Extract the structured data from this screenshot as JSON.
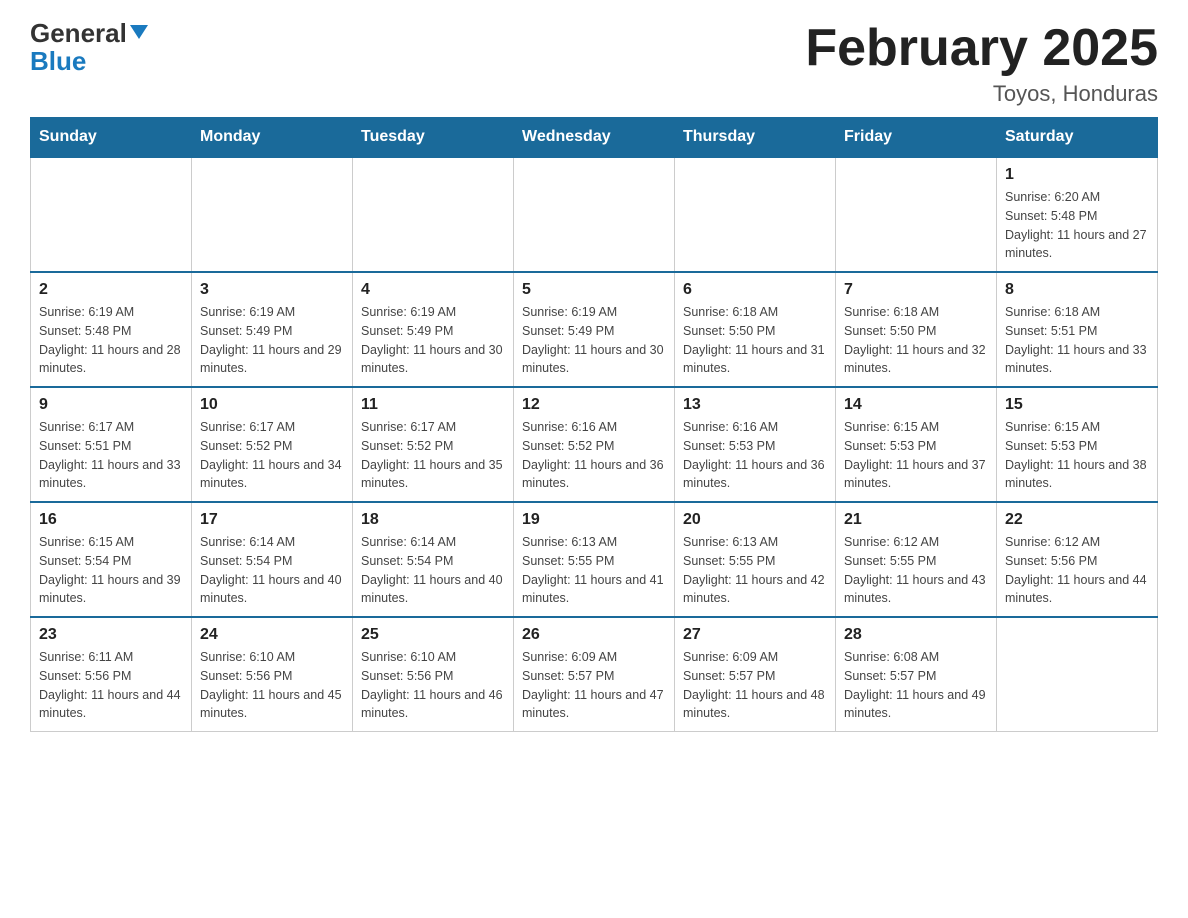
{
  "logo": {
    "general": "General",
    "blue": "Blue"
  },
  "header": {
    "month_title": "February 2025",
    "location": "Toyos, Honduras"
  },
  "weekdays": [
    "Sunday",
    "Monday",
    "Tuesday",
    "Wednesday",
    "Thursday",
    "Friday",
    "Saturday"
  ],
  "weeks": [
    [
      {
        "day": "",
        "info": ""
      },
      {
        "day": "",
        "info": ""
      },
      {
        "day": "",
        "info": ""
      },
      {
        "day": "",
        "info": ""
      },
      {
        "day": "",
        "info": ""
      },
      {
        "day": "",
        "info": ""
      },
      {
        "day": "1",
        "info": "Sunrise: 6:20 AM\nSunset: 5:48 PM\nDaylight: 11 hours and 27 minutes."
      }
    ],
    [
      {
        "day": "2",
        "info": "Sunrise: 6:19 AM\nSunset: 5:48 PM\nDaylight: 11 hours and 28 minutes."
      },
      {
        "day": "3",
        "info": "Sunrise: 6:19 AM\nSunset: 5:49 PM\nDaylight: 11 hours and 29 minutes."
      },
      {
        "day": "4",
        "info": "Sunrise: 6:19 AM\nSunset: 5:49 PM\nDaylight: 11 hours and 30 minutes."
      },
      {
        "day": "5",
        "info": "Sunrise: 6:19 AM\nSunset: 5:49 PM\nDaylight: 11 hours and 30 minutes."
      },
      {
        "day": "6",
        "info": "Sunrise: 6:18 AM\nSunset: 5:50 PM\nDaylight: 11 hours and 31 minutes."
      },
      {
        "day": "7",
        "info": "Sunrise: 6:18 AM\nSunset: 5:50 PM\nDaylight: 11 hours and 32 minutes."
      },
      {
        "day": "8",
        "info": "Sunrise: 6:18 AM\nSunset: 5:51 PM\nDaylight: 11 hours and 33 minutes."
      }
    ],
    [
      {
        "day": "9",
        "info": "Sunrise: 6:17 AM\nSunset: 5:51 PM\nDaylight: 11 hours and 33 minutes."
      },
      {
        "day": "10",
        "info": "Sunrise: 6:17 AM\nSunset: 5:52 PM\nDaylight: 11 hours and 34 minutes."
      },
      {
        "day": "11",
        "info": "Sunrise: 6:17 AM\nSunset: 5:52 PM\nDaylight: 11 hours and 35 minutes."
      },
      {
        "day": "12",
        "info": "Sunrise: 6:16 AM\nSunset: 5:52 PM\nDaylight: 11 hours and 36 minutes."
      },
      {
        "day": "13",
        "info": "Sunrise: 6:16 AM\nSunset: 5:53 PM\nDaylight: 11 hours and 36 minutes."
      },
      {
        "day": "14",
        "info": "Sunrise: 6:15 AM\nSunset: 5:53 PM\nDaylight: 11 hours and 37 minutes."
      },
      {
        "day": "15",
        "info": "Sunrise: 6:15 AM\nSunset: 5:53 PM\nDaylight: 11 hours and 38 minutes."
      }
    ],
    [
      {
        "day": "16",
        "info": "Sunrise: 6:15 AM\nSunset: 5:54 PM\nDaylight: 11 hours and 39 minutes."
      },
      {
        "day": "17",
        "info": "Sunrise: 6:14 AM\nSunset: 5:54 PM\nDaylight: 11 hours and 40 minutes."
      },
      {
        "day": "18",
        "info": "Sunrise: 6:14 AM\nSunset: 5:54 PM\nDaylight: 11 hours and 40 minutes."
      },
      {
        "day": "19",
        "info": "Sunrise: 6:13 AM\nSunset: 5:55 PM\nDaylight: 11 hours and 41 minutes."
      },
      {
        "day": "20",
        "info": "Sunrise: 6:13 AM\nSunset: 5:55 PM\nDaylight: 11 hours and 42 minutes."
      },
      {
        "day": "21",
        "info": "Sunrise: 6:12 AM\nSunset: 5:55 PM\nDaylight: 11 hours and 43 minutes."
      },
      {
        "day": "22",
        "info": "Sunrise: 6:12 AM\nSunset: 5:56 PM\nDaylight: 11 hours and 44 minutes."
      }
    ],
    [
      {
        "day": "23",
        "info": "Sunrise: 6:11 AM\nSunset: 5:56 PM\nDaylight: 11 hours and 44 minutes."
      },
      {
        "day": "24",
        "info": "Sunrise: 6:10 AM\nSunset: 5:56 PM\nDaylight: 11 hours and 45 minutes."
      },
      {
        "day": "25",
        "info": "Sunrise: 6:10 AM\nSunset: 5:56 PM\nDaylight: 11 hours and 46 minutes."
      },
      {
        "day": "26",
        "info": "Sunrise: 6:09 AM\nSunset: 5:57 PM\nDaylight: 11 hours and 47 minutes."
      },
      {
        "day": "27",
        "info": "Sunrise: 6:09 AM\nSunset: 5:57 PM\nDaylight: 11 hours and 48 minutes."
      },
      {
        "day": "28",
        "info": "Sunrise: 6:08 AM\nSunset: 5:57 PM\nDaylight: 11 hours and 49 minutes."
      },
      {
        "day": "",
        "info": ""
      }
    ]
  ]
}
